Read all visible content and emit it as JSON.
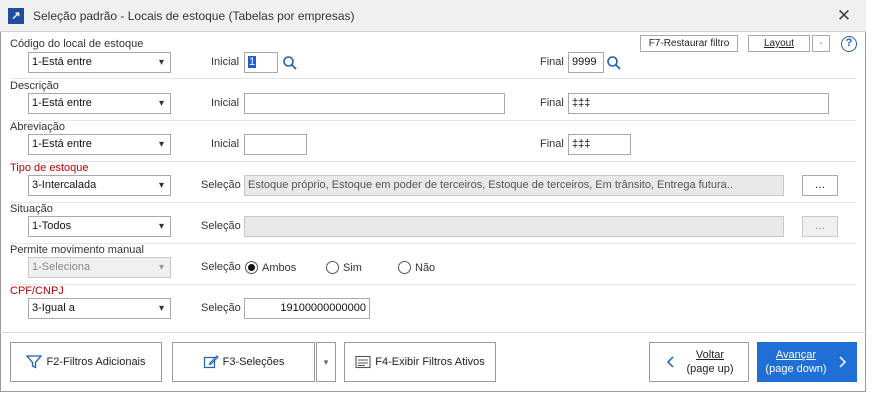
{
  "window": {
    "title": "Seleção padrão - Locais de estoque (Tabelas por empresas)"
  },
  "toolbar": {
    "restore_filter": "F7-Restaurar filtro",
    "layout": "Layout",
    "layout_dd": "-",
    "help": "?"
  },
  "fields": {
    "codigo": {
      "label": "Código do local de estoque",
      "op": "1-Está entre",
      "inicial_label": "Inicial",
      "inicial": "1",
      "final_label": "Final",
      "final": "9999"
    },
    "descricao": {
      "label": "Descrição",
      "op": "1-Está entre",
      "inicial_label": "Inicial",
      "inicial": "",
      "final_label": "Final",
      "final": "‡‡‡"
    },
    "abreviacao": {
      "label": "Abreviação",
      "op": "1-Está entre",
      "inicial_label": "Inicial",
      "inicial": "",
      "final_label": "Final",
      "final": "‡‡‡"
    },
    "tipo": {
      "label": "Tipo de estoque",
      "op": "3-Intercalada",
      "selecao_label": "Seleção",
      "selecao": "Estoque próprio, Estoque em poder de terceiros, Estoque de terceiros, Em trânsito, Entrega futura..",
      "dots": "..."
    },
    "situacao": {
      "label": "Situação",
      "op": "1-Todos",
      "selecao_label": "Seleção",
      "selecao": "",
      "dots": "..."
    },
    "movimento": {
      "label": "Permite movimento manual",
      "op": "1-Seleciona",
      "selecao_label": "Seleção",
      "options": [
        "Ambos",
        "Sim",
        "Não"
      ],
      "selected": "Ambos"
    },
    "cpf": {
      "label": "CPF/CNPJ",
      "op": "3-Igual a",
      "selecao_label": "Seleção",
      "selecao": "19100000000000"
    }
  },
  "footer": {
    "filtros": "F2-Filtros Adicionais",
    "selecoes": "F3-Seleções",
    "exibir": "F4-Exibir Filtros Ativos",
    "voltar": "Voltar",
    "voltar_sub": "(page up)",
    "avancar": "Avançar",
    "avancar_sub": "(page down)"
  },
  "colors": {
    "accent": "#1f6fd6",
    "required_label": "#c00000",
    "icon_blue": "#1f5fb8"
  },
  "icons": [
    "app-icon",
    "close-icon",
    "search-icon",
    "filter-icon",
    "edit-icon",
    "list-icon",
    "chevron-left-icon",
    "chevron-right-icon",
    "chevron-down-icon",
    "help-icon"
  ]
}
